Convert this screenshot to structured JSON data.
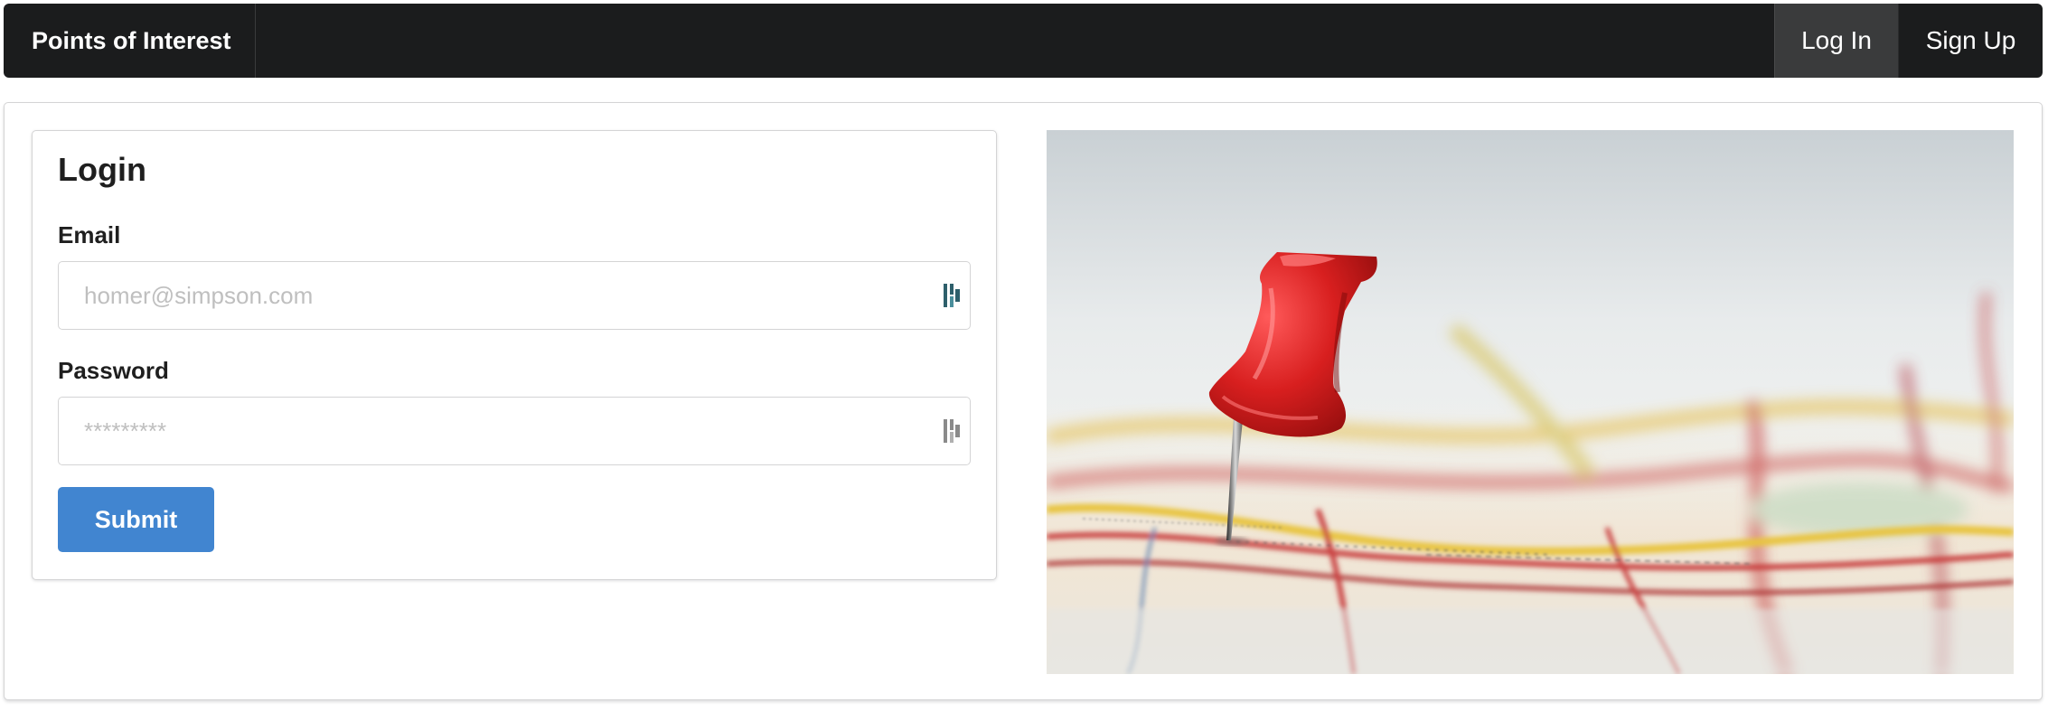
{
  "navbar": {
    "brand": "Points of Interest",
    "login_label": "Log In",
    "signup_label": "Sign Up"
  },
  "login_form": {
    "title": "Login",
    "email_label": "Email",
    "email_placeholder": "homer@simpson.com",
    "email_value": "",
    "password_label": "Password",
    "password_placeholder": "*********",
    "password_value": "",
    "submit_label": "Submit"
  },
  "icons": {
    "email_field_icon": "password-manager-icon",
    "password_field_icon": "password-manager-icon",
    "photo": "red-pushpin-on-map-photo"
  },
  "colors": {
    "navbar_bg": "#1b1c1d",
    "navbar_active_bg": "#3a3b3c",
    "submit_bg": "#4185d0",
    "pin_red": "#d81f1f",
    "pm_icon_active": "#2e5f6b",
    "pm_icon_inactive": "#8a8a8a"
  }
}
